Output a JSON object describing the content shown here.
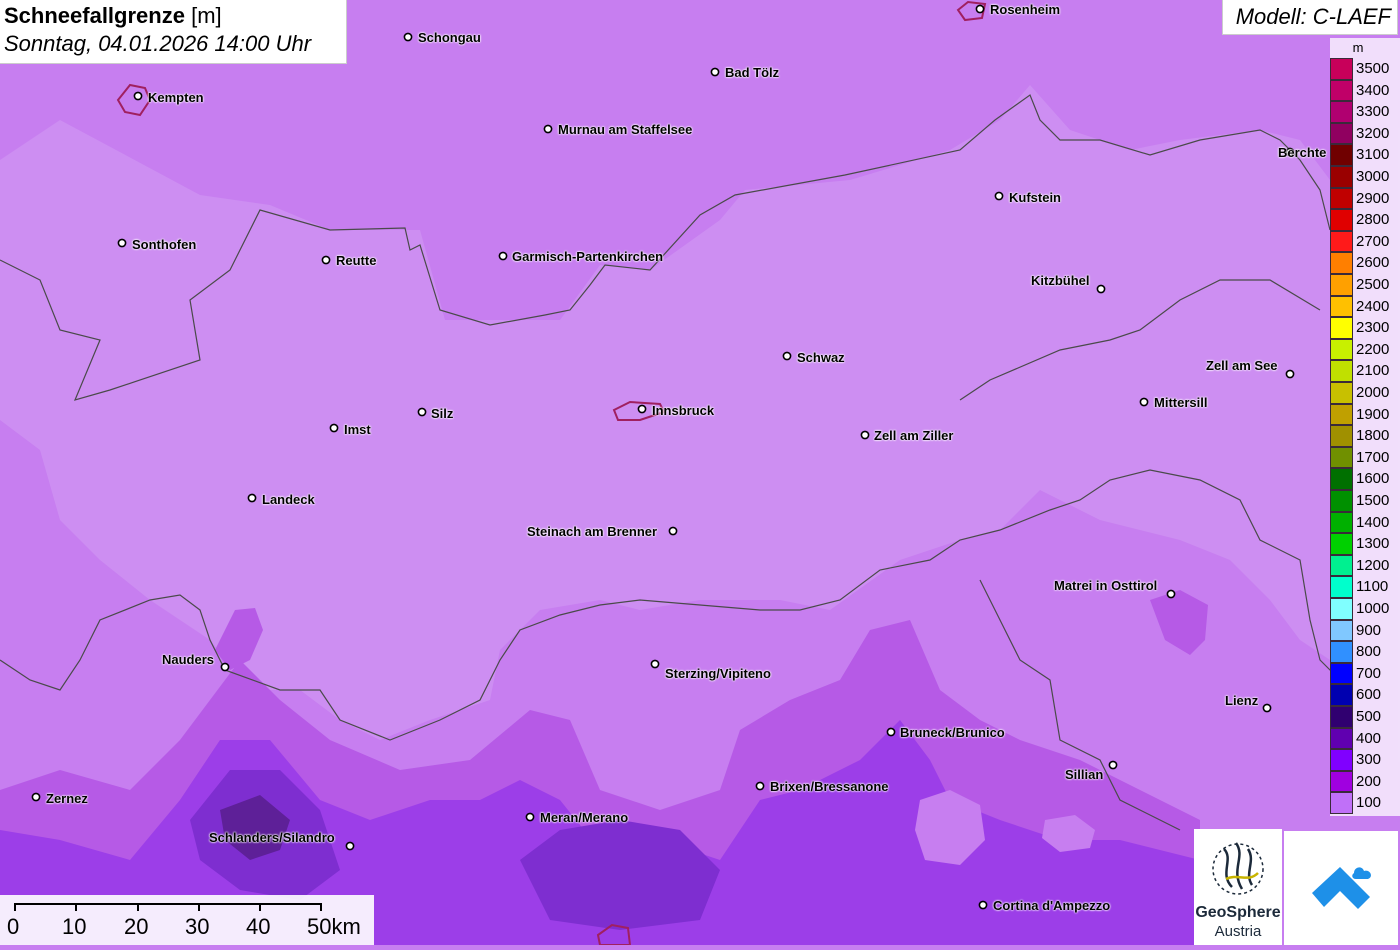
{
  "title": {
    "main": "Schneefallgrenze",
    "unit": "[m]",
    "datetime": "Sonntag, 04.01.2026 14:00 Uhr"
  },
  "model": "Modell: C-LAEF",
  "legend": {
    "unit": "m",
    "entries": [
      {
        "label": "3500",
        "color": "#c8005a"
      },
      {
        "label": "3400",
        "color": "#c00068"
      },
      {
        "label": "3300",
        "color": "#b00070"
      },
      {
        "label": "3200",
        "color": "#900060"
      },
      {
        "label": "3100",
        "color": "#700000"
      },
      {
        "label": "3000",
        "color": "#9a0000"
      },
      {
        "label": "2900",
        "color": "#c00000"
      },
      {
        "label": "2800",
        "color": "#e00000"
      },
      {
        "label": "2700",
        "color": "#ff1a1a"
      },
      {
        "label": "2600",
        "color": "#ff7f00"
      },
      {
        "label": "2500",
        "color": "#ffa000"
      },
      {
        "label": "2400",
        "color": "#ffc000"
      },
      {
        "label": "2300",
        "color": "#ffff00"
      },
      {
        "label": "2200",
        "color": "#c8f000"
      },
      {
        "label": "2100",
        "color": "#c0e000"
      },
      {
        "label": "2000",
        "color": "#c8c000"
      },
      {
        "label": "1900",
        "color": "#c0a000"
      },
      {
        "label": "1800",
        "color": "#a09000"
      },
      {
        "label": "1700",
        "color": "#709000"
      },
      {
        "label": "1600",
        "color": "#007000"
      },
      {
        "label": "1500",
        "color": "#009000"
      },
      {
        "label": "1400",
        "color": "#00b000"
      },
      {
        "label": "1300",
        "color": "#00d000"
      },
      {
        "label": "1200",
        "color": "#00f090"
      },
      {
        "label": "1100",
        "color": "#00ffcc"
      },
      {
        "label": "1000",
        "color": "#80ffff"
      },
      {
        "label": "900",
        "color": "#80c8ff"
      },
      {
        "label": "800",
        "color": "#3090ff"
      },
      {
        "label": "700",
        "color": "#0000ff"
      },
      {
        "label": "600",
        "color": "#0000b0"
      },
      {
        "label": "500",
        "color": "#300070"
      },
      {
        "label": "400",
        "color": "#6000b0"
      },
      {
        "label": "300",
        "color": "#8000ff"
      },
      {
        "label": "200",
        "color": "#a000e0"
      },
      {
        "label": "100",
        "color": "#c070f8"
      }
    ]
  },
  "scalebar": {
    "labels": [
      "0",
      "10",
      "20",
      "30",
      "40",
      "50km"
    ]
  },
  "cities": [
    {
      "name": "Rosenheim"
    },
    {
      "name": "Schongau"
    },
    {
      "name": "Bad Tölz"
    },
    {
      "name": "Kempten"
    },
    {
      "name": "Murnau am Staffelsee"
    },
    {
      "name": "Berchte"
    },
    {
      "name": "Kufstein"
    },
    {
      "name": "Sonthofen"
    },
    {
      "name": "Reutte"
    },
    {
      "name": "Garmisch-Partenkirchen"
    },
    {
      "name": "Kitzbühel"
    },
    {
      "name": "Schwaz"
    },
    {
      "name": "Zell am See"
    },
    {
      "name": "Mittersill"
    },
    {
      "name": "Silz"
    },
    {
      "name": "Innsbruck"
    },
    {
      "name": "Imst"
    },
    {
      "name": "Zell am Ziller"
    },
    {
      "name": "Landeck"
    },
    {
      "name": "Steinach am Brenner"
    },
    {
      "name": "Matrei in Osttirol"
    },
    {
      "name": "Nauders"
    },
    {
      "name": "Sterzing/Vipiteno"
    },
    {
      "name": "Lienz"
    },
    {
      "name": "Bruneck/Brunico"
    },
    {
      "name": "Sillian"
    },
    {
      "name": "Zernez"
    },
    {
      "name": "Brixen/Bressanone"
    },
    {
      "name": "Meran/Merano"
    },
    {
      "name": "Schlanders/Silandro"
    },
    {
      "name": "Cortina d'Ampezzo"
    }
  ],
  "logos": {
    "geosphere_line1": "GeoSphere",
    "geosphere_line2": "Austria"
  }
}
